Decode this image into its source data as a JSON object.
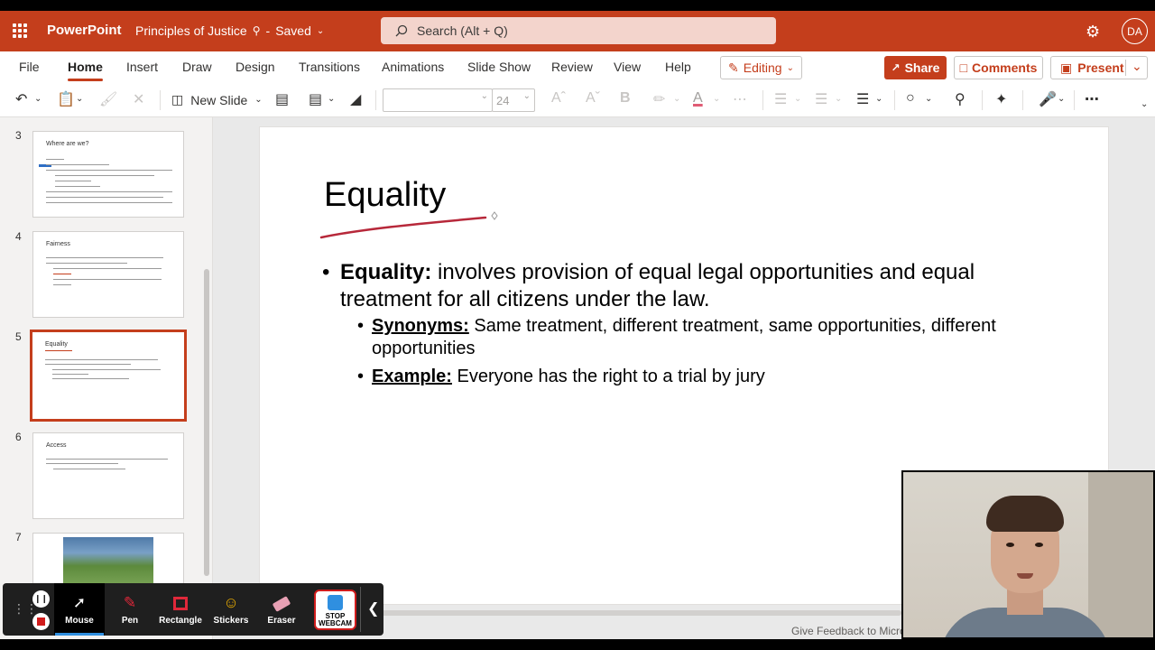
{
  "app": {
    "name": "PowerPoint",
    "document_name": "Principles of Justice",
    "save_status": "Saved",
    "search_placeholder": "Search (Alt + Q)",
    "user_initials": "DA",
    "accent_color": "#c43e1c"
  },
  "ribbon": {
    "tabs": [
      "File",
      "Home",
      "Insert",
      "Draw",
      "Design",
      "Transitions",
      "Animations",
      "Slide Show",
      "Review",
      "View",
      "Help"
    ],
    "active_tab": "Home",
    "editing_label": "Editing",
    "share_label": "Share",
    "comments_label": "Comments",
    "present_label": "Present"
  },
  "toolbar": {
    "new_slide_label": "New Slide",
    "font_name": "",
    "font_size": "24",
    "bold_label": "B"
  },
  "slides_panel": [
    {
      "number": "3",
      "title": "Where are we?"
    },
    {
      "number": "4",
      "title": "Fairness"
    },
    {
      "number": "5",
      "title": "Equality",
      "selected": true
    },
    {
      "number": "6",
      "title": "Access"
    },
    {
      "number": "7",
      "title": ""
    }
  ],
  "current_slide": {
    "title": "Equality",
    "bullet_label": "Equality:",
    "bullet_text": " involves provision of equal legal opportunities and equal treatment for all citizens under the law.",
    "sub_bullets": [
      {
        "label": "Synonyms:",
        "text": " Same treatment, different treatment, same opportunities, different opportunities"
      },
      {
        "label": "Example:",
        "text": " Everyone has the right to a trial by jury"
      }
    ]
  },
  "status_bar": {
    "feedback_text": "Give Feedback to Micros"
  },
  "recorder": {
    "tools": [
      "Mouse",
      "Pen",
      "Rectangle",
      "Stickers",
      "Eraser"
    ],
    "active_tool": "Mouse",
    "stop_webcam_line1": "STOP",
    "stop_webcam_line2": "WEBCAM"
  }
}
